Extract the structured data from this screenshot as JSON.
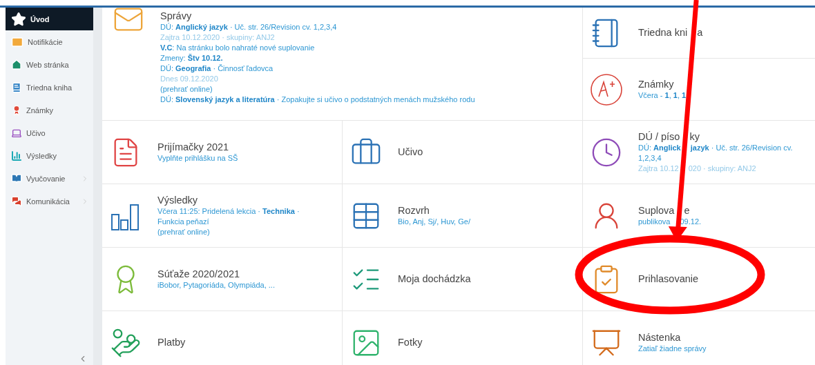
{
  "sidebar": {
    "items": [
      {
        "label": "Úvod",
        "selected": true,
        "has_submenu": false
      },
      {
        "label": "Notifikácie",
        "selected": false,
        "has_submenu": false
      },
      {
        "label": "Web stránka",
        "selected": false,
        "has_submenu": false
      },
      {
        "label": "Triedna kniha",
        "selected": false,
        "has_submenu": false
      },
      {
        "label": "Známky",
        "selected": false,
        "has_submenu": false
      },
      {
        "label": "Učivo",
        "selected": false,
        "has_submenu": false
      },
      {
        "label": "Výsledky",
        "selected": false,
        "has_submenu": false
      },
      {
        "label": "Vyučovanie",
        "selected": false,
        "has_submenu": true
      },
      {
        "label": "Komunikácia",
        "selected": false,
        "has_submenu": true
      }
    ]
  },
  "tiles": [
    {
      "title": "Správy",
      "lines": [
        {
          "kind": "info",
          "text": "DÚ: **Anglický jazyk** · Uč. str. 26/Revision cv. 1,2,3,4"
        },
        {
          "kind": "date",
          "text": "Zajtra 10.12.2020 · skupiny: ANJ2"
        },
        {
          "kind": "info",
          "text": "**V.C**: Na stránku bolo nahraté nové suplovanie"
        },
        {
          "kind": "info",
          "text": "Zmeny: **Štv 10.12.**"
        },
        {
          "kind": "info",
          "text": "DÚ: **Geografia** · Činnosť ľadovca"
        },
        {
          "kind": "date",
          "text": "Dnes 09.12.2020"
        },
        {
          "kind": "info",
          "text": "(prehrať online)"
        },
        {
          "kind": "info",
          "text": "DÚ: **Slovenský jazyk a literatúra** · Zopakujte si učivo o podstatných menách mužského rodu"
        }
      ]
    },
    {
      "title": "Triedna kni",
      "title_rest": "a"
    },
    {
      "title": "Známky",
      "lines": [
        {
          "kind": "info",
          "text": "Včera - **1**, **1**, **1**"
        }
      ]
    },
    {
      "title": "Prijímačky 2021",
      "lines": [
        {
          "kind": "info",
          "text": "Vyplňte prihlášku na SŠ"
        }
      ]
    },
    {
      "title": "Učivo"
    },
    {
      "title": "DÚ / píso",
      "title_rest": "ky",
      "lines": [
        {
          "kind": "info",
          "text": "DÚ: **Anglick**",
          "rest": "**jazyk** · Uč. str. 26/Revision cv."
        },
        {
          "kind": "info",
          "text": "1,2,3,4"
        },
        {
          "kind": "date",
          "text": "Zajtra 10.12",
          "rest": "020 · skupiny: ANJ2"
        }
      ]
    },
    {
      "title": "Výsledky",
      "lines": [
        {
          "kind": "info",
          "text": "Včera 11:25: Pridelená lekcia · **Technika** ·"
        },
        {
          "kind": "info",
          "text": "Funkcia peňazí"
        },
        {
          "kind": "info",
          "text": "(prehrať online)"
        }
      ]
    },
    {
      "title": "Rozvrh",
      "lines": [
        {
          "kind": "info",
          "text": "Bio, Anj, Sj/, Huv, Ge/"
        }
      ]
    },
    {
      "title": "Suplova",
      "title_rest": "e",
      "lines": [
        {
          "kind": "info",
          "text": "publikova",
          "rest": "09.12."
        }
      ]
    },
    {
      "title": "Súťaže 2020/2021",
      "lines": [
        {
          "kind": "info",
          "text": "iBobor, Pytagoriáda, Olympiáda, ..."
        }
      ]
    },
    {
      "title": "Moja dochádzka"
    },
    {
      "title": "Prihlasovanie"
    },
    {
      "title": "Platby"
    },
    {
      "title": "Fotky"
    },
    {
      "title": "Nástenka",
      "lines": [
        {
          "kind": "info",
          "text": "Zatiaľ žiadne správy"
        }
      ]
    }
  ]
}
